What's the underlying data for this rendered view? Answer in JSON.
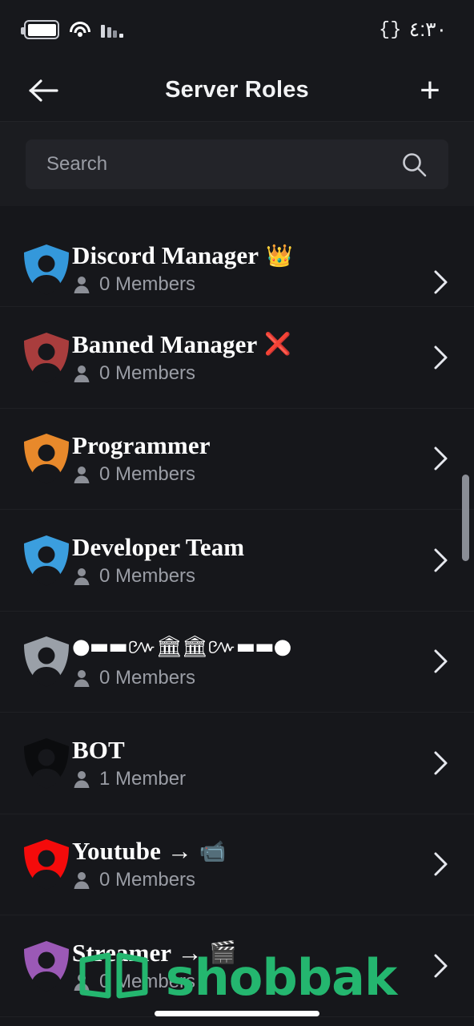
{
  "statusbar": {
    "battery_icon": "battery-full-icon",
    "wifi_icon": "wifi-icon",
    "signal_icon": "signal-bars-icon",
    "brace_icon": "{}",
    "time": "٤:٣٠"
  },
  "header": {
    "back_icon": "arrow-left-icon",
    "title": "Server Roles",
    "add_label": "+"
  },
  "search": {
    "placeholder": "Search",
    "value": "",
    "icon": "search-icon"
  },
  "colors": {
    "background": "#16171b",
    "surface": "#1b1c20",
    "header": "#17181c",
    "divider": "#1f2024",
    "text_primary": "#ffffff",
    "text_secondary": "#9a9da5",
    "watermark_green": "#24b66f"
  },
  "roles": [
    {
      "name": "Discord Manager",
      "emoji": "👑",
      "members": "0 Members",
      "color": "#3498db",
      "clipped": true
    },
    {
      "name": "Banned Manager",
      "emoji": "❌",
      "members": "0 Members",
      "color": "#a93d3d",
      "clipped": false
    },
    {
      "name": "Programmer",
      "emoji": "",
      "members": "0 Members",
      "color": "#e8892b",
      "clipped": false
    },
    {
      "name": "Developer Team",
      "emoji": "",
      "members": "0 Members",
      "color": "#3b9ede",
      "clipped": false
    },
    {
      "name": "●▬▬៚🏛🏛៚▬▬●",
      "emoji": "",
      "members": "0 Members",
      "color": "#9aa0a8",
      "clipped": false,
      "decorative": true
    },
    {
      "name": "BOT",
      "emoji": "",
      "members": "1 Member",
      "color": "#0b0c0e",
      "clipped": false
    },
    {
      "name": "Youtube →",
      "emoji": "📹",
      "members": "0 Members",
      "color": "#f50b0b",
      "clipped": false
    },
    {
      "name": "Streamer →",
      "emoji": "🎬",
      "members": "0 Members",
      "color": "#9b59b6",
      "clipped": false
    }
  ],
  "scrollbar": {
    "visible": true
  },
  "watermark": {
    "text": "shobbak",
    "logo_icon": "shobbak-windows-logo"
  }
}
